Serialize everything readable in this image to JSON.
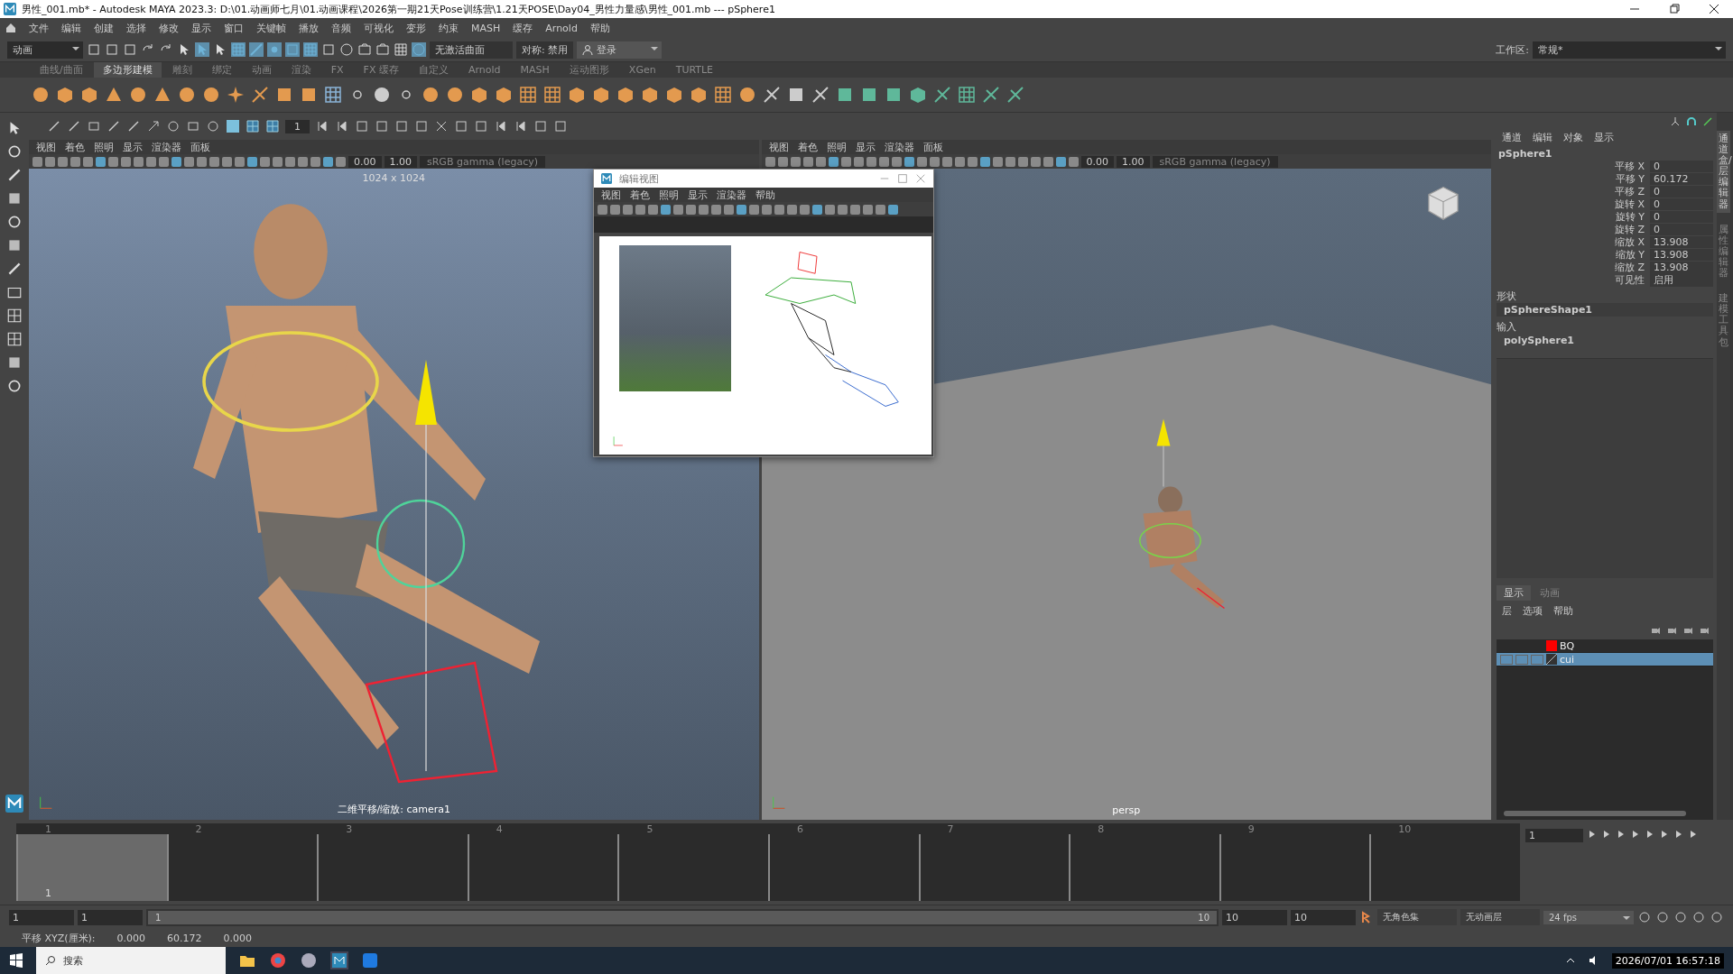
{
  "window": {
    "title": "男性_001.mb* - Autodesk MAYA 2023.3: D:\\01.动画师七月\\01.动画课程\\2026第一期21天Pose训练营\\1.21天POSE\\Day04_男性力量感\\男性_001.mb  ---  pSphere1"
  },
  "menu_bar": [
    "文件",
    "编辑",
    "创建",
    "选择",
    "修改",
    "显示",
    "窗口",
    "关键帧",
    "播放",
    "音频",
    "可视化",
    "变形",
    "约束",
    "MASH",
    "缓存",
    "Arnold",
    "帮助"
  ],
  "status_line": {
    "mode": "动画",
    "curve_field": "无激活曲面",
    "symmetry": "对称: 禁用",
    "login": "登录",
    "workspace_label": "工作区:",
    "workspace": "常规*"
  },
  "shelf": {
    "tabs": [
      {
        "label": "曲线/曲面",
        "selected": false
      },
      {
        "label": "多边形建模",
        "selected": true
      },
      {
        "label": "雕刻",
        "selected": false
      },
      {
        "label": "绑定",
        "selected": false
      },
      {
        "label": "动画",
        "selected": false
      },
      {
        "label": "渲染",
        "selected": false
      },
      {
        "label": "FX",
        "selected": false
      },
      {
        "label": "FX 缓存",
        "selected": false
      },
      {
        "label": "自定义",
        "selected": false
      },
      {
        "label": "Arnold",
        "selected": false
      },
      {
        "label": "MASH",
        "selected": false
      },
      {
        "label": "运动图形",
        "selected": false
      },
      {
        "label": "XGen",
        "selected": false
      },
      {
        "label": "TURTLE",
        "selected": false
      }
    ]
  },
  "pencil_toolbar": {
    "size": "1"
  },
  "viewports": [
    {
      "menus": [
        "视图",
        "着色",
        "照明",
        "显示",
        "渲染器",
        "面板"
      ],
      "exposure": "0.00",
      "gamma": "1.00",
      "color_space": "sRGB gamma (legacy)",
      "resolution": "1024 x 1024",
      "camera": "二维平移/缩放: camera1",
      "kind": "bluepencil"
    },
    {
      "menus": [
        "视图",
        "着色",
        "照明",
        "显示",
        "渲染器",
        "面板"
      ],
      "exposure": "0.00",
      "gamma": "1.00",
      "color_space": "sRGB gamma (legacy)",
      "camera": "persp",
      "kind": "perspective"
    }
  ],
  "floating_window": {
    "title": "编辑视图",
    "menus": [
      "视图",
      "着色",
      "照明",
      "显示",
      "渲染器",
      "帮助"
    ]
  },
  "channel_box": {
    "tabs": [
      "通道",
      "编辑",
      "对象",
      "显示"
    ],
    "object": "pSphere1",
    "attributes": [
      {
        "name": "平移 X",
        "value": "0"
      },
      {
        "name": "平移 Y",
        "value": "60.172"
      },
      {
        "name": "平移 Z",
        "value": "0"
      },
      {
        "name": "旋转 X",
        "value": "0"
      },
      {
        "name": "旋转 Y",
        "value": "0"
      },
      {
        "name": "旋转 Z",
        "value": "0"
      },
      {
        "name": "缩放 X",
        "value": "13.908"
      },
      {
        "name": "缩放 Y",
        "value": "13.908"
      },
      {
        "name": "缩放 Z",
        "value": "13.908"
      },
      {
        "name": "可见性",
        "value": "启用"
      }
    ],
    "shape_label": "形状",
    "shape": "pSphereShape1",
    "input_label": "输入",
    "input": "polySphere1"
  },
  "side_tabs": [
    {
      "label": "通道盒/层编辑器",
      "selected": true
    },
    {
      "label": "属性编辑器",
      "selected": false
    },
    {
      "label": "建模工具包",
      "selected": false
    }
  ],
  "layer_editor": {
    "tabs": [
      {
        "label": "显示",
        "selected": true
      },
      {
        "label": "动画",
        "selected": false
      }
    ],
    "menus": [
      "层",
      "选项",
      "帮助"
    ],
    "layers": [
      {
        "name": "BQ",
        "color": "#ff0000",
        "selected": false
      },
      {
        "name": "cui",
        "selected": true
      }
    ]
  },
  "timeline": {
    "ticks": [
      {
        "label": "1",
        "selected": true
      },
      {
        "label": "2",
        "selected": false
      },
      {
        "label": "3",
        "selected": false
      },
      {
        "label": "4",
        "selected": false
      },
      {
        "label": "5",
        "selected": false
      },
      {
        "label": "6",
        "selected": false
      },
      {
        "label": "7",
        "selected": false
      },
      {
        "label": "8",
        "selected": false
      },
      {
        "label": "9",
        "selected": false
      },
      {
        "label": "10",
        "selected": false
      }
    ],
    "current_frame": "1"
  },
  "playback": {
    "current_time": "1"
  },
  "range_slider": {
    "start": "1",
    "inner_start": "1",
    "slider_start": "1",
    "slider_end": "10",
    "inner_end": "10",
    "end": "10",
    "level": 1,
    "character_set": "无角色集",
    "anim_layer": "无动画层",
    "fps": "24 fps"
  },
  "help_line": {
    "label": "平移 XYZ(厘米):",
    "values": [
      "0.000",
      "60.172",
      "0.000"
    ]
  },
  "taskbar": {
    "search": "搜索",
    "clock": "2026/07/01 16:57:18"
  }
}
